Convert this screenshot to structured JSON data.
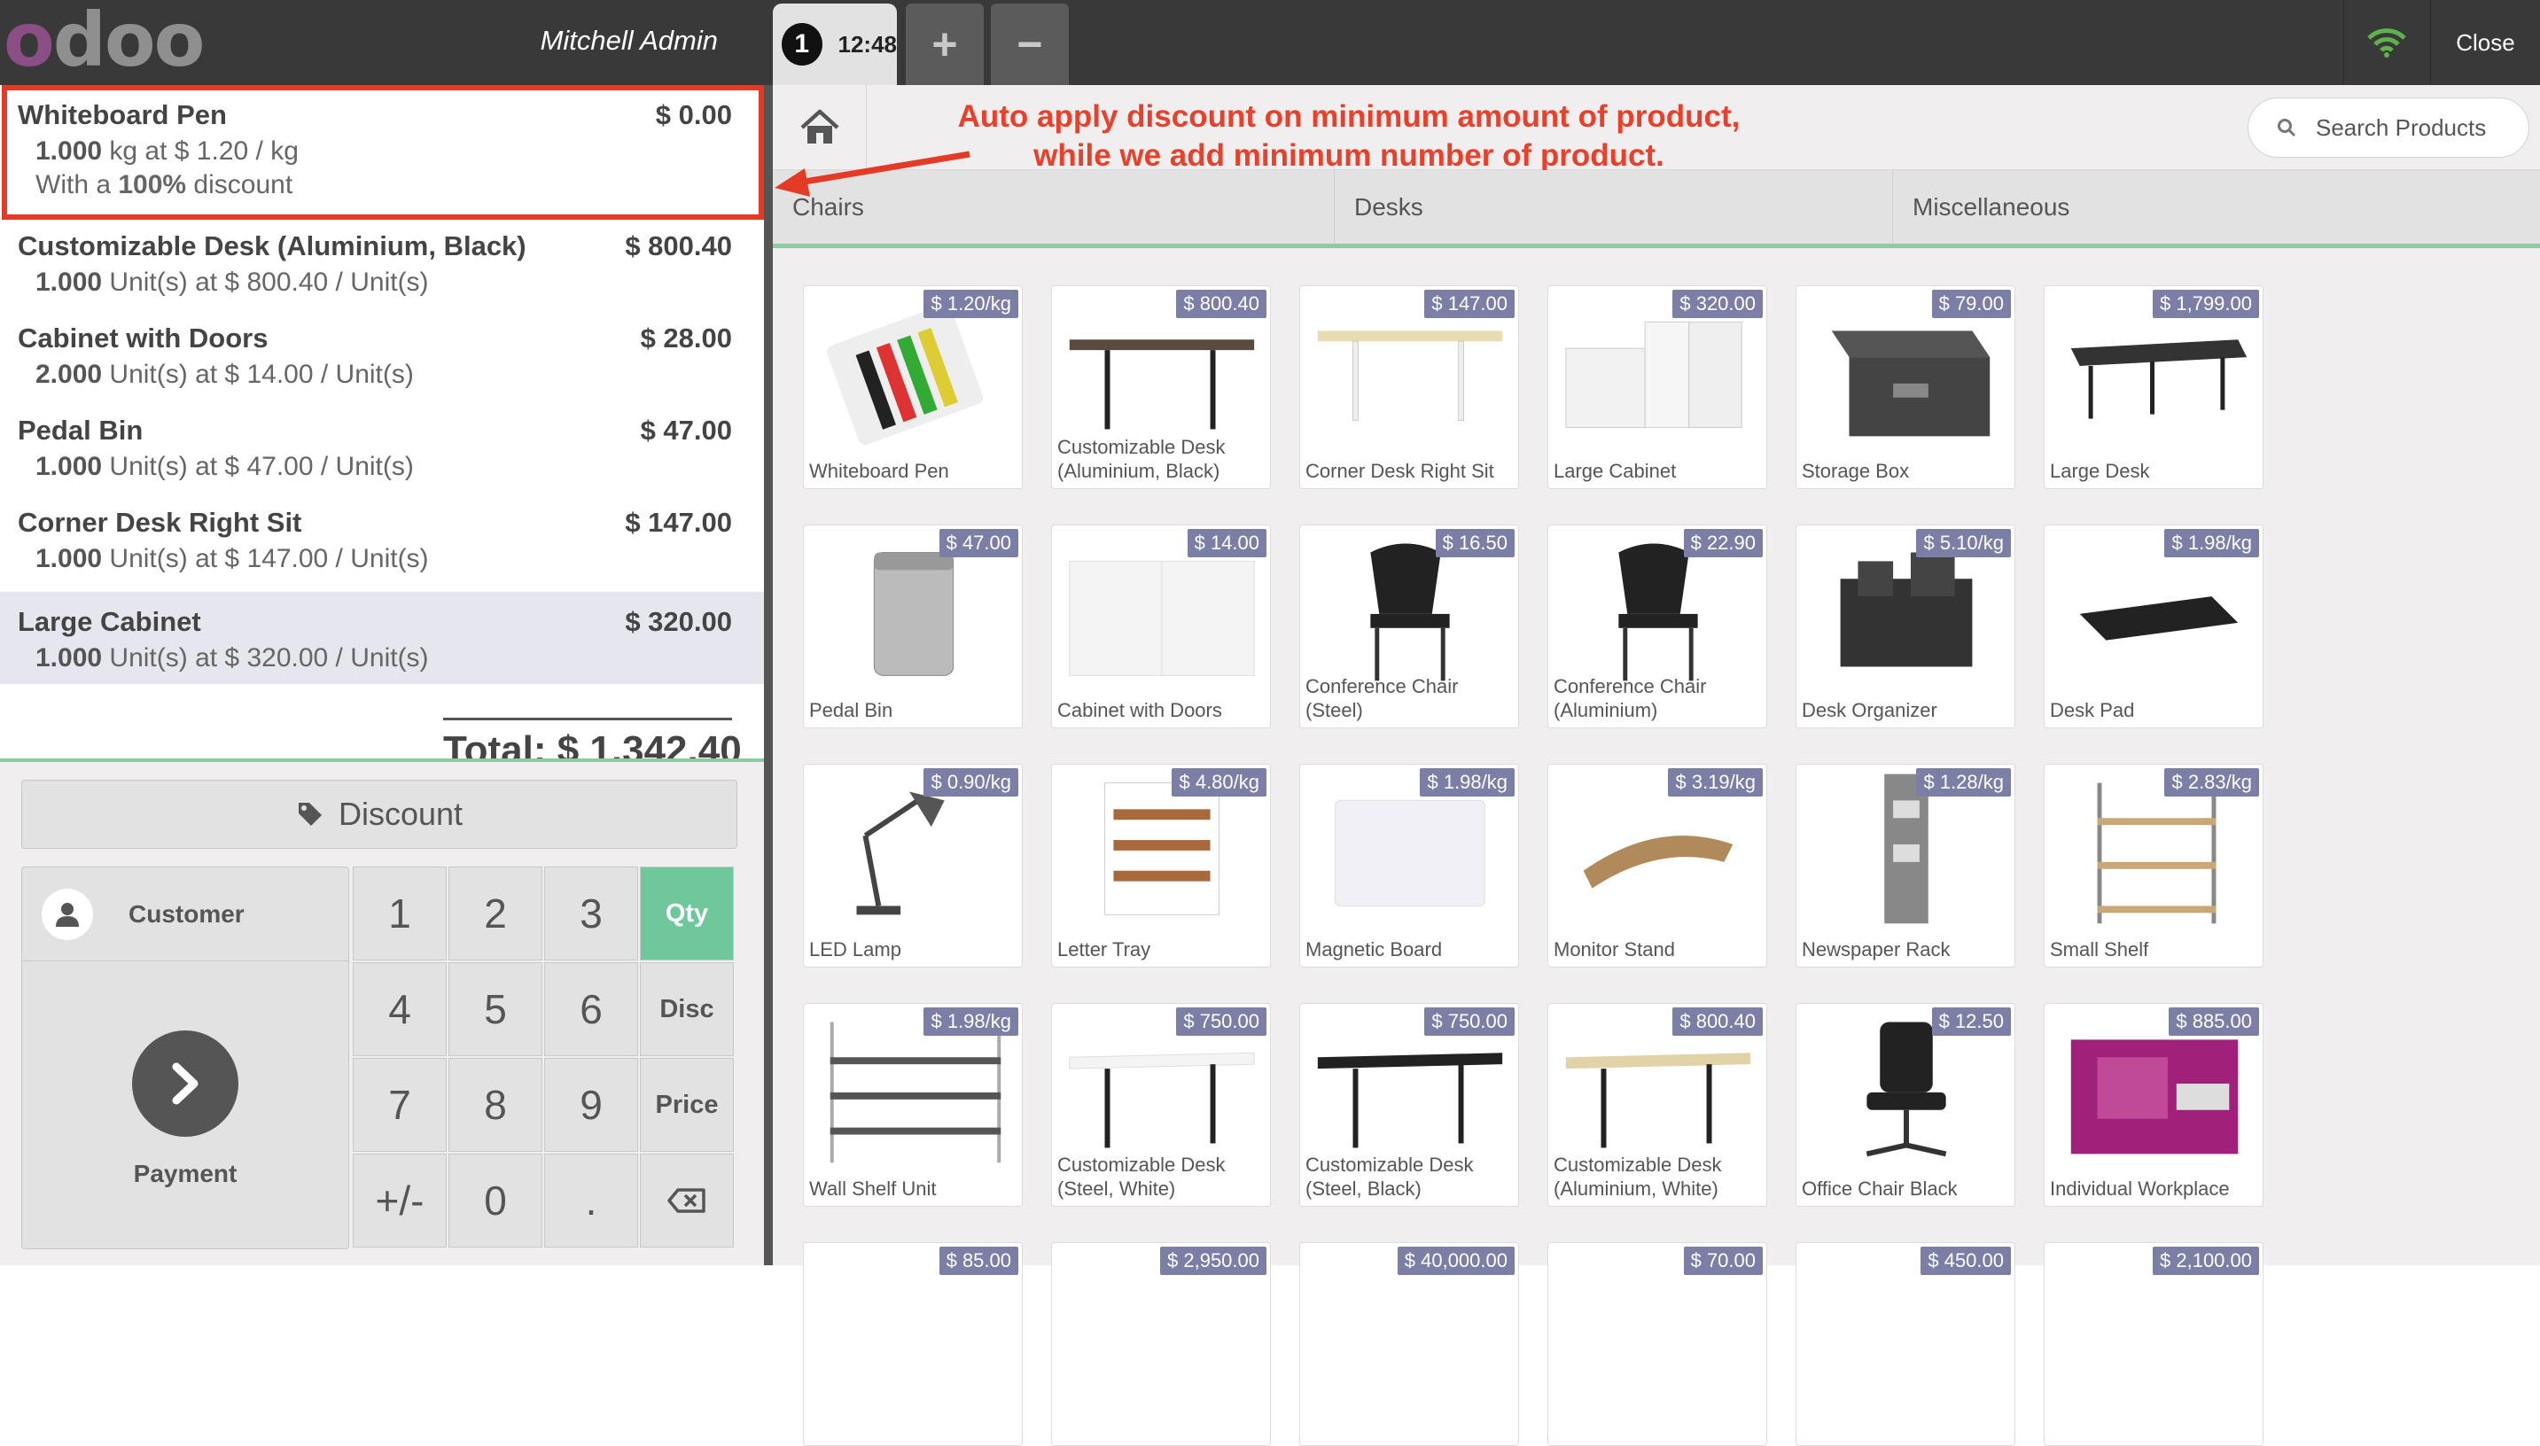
{
  "topbar": {
    "logo_letters": [
      "o",
      "d",
      "o",
      "o"
    ],
    "cashier": "Mitchell Admin",
    "order_number": "1",
    "order_time": "12:48",
    "add_label": "+",
    "remove_label": "−",
    "close_label": "Close",
    "wifi_color": "#5fb14a"
  },
  "order": {
    "lines": [
      {
        "name": "Whiteboard Pen",
        "price": "$ 0.00",
        "qty": "1.000",
        "unit_info": " kg at $ 1.20 / kg",
        "discount_prefix": "With a ",
        "discount_value": "100%",
        "discount_suffix": " discount"
      },
      {
        "name": "Customizable Desk (Aluminium, Black)",
        "price": "$ 800.40",
        "qty": "1.000",
        "unit_info": " Unit(s) at $ 800.40 / Unit(s)"
      },
      {
        "name": "Cabinet with Doors",
        "price": "$ 28.00",
        "qty": "2.000",
        "unit_info": " Unit(s) at $ 14.00 / Unit(s)"
      },
      {
        "name": "Pedal Bin",
        "price": "$ 47.00",
        "qty": "1.000",
        "unit_info": " Unit(s) at $ 47.00 / Unit(s)"
      },
      {
        "name": "Corner Desk Right Sit",
        "price": "$ 147.00",
        "qty": "1.000",
        "unit_info": " Unit(s) at $ 147.00 / Unit(s)"
      },
      {
        "name": "Large Cabinet",
        "price": "$ 320.00",
        "qty": "1.000",
        "unit_info": " Unit(s) at $ 320.00 / Unit(s)"
      }
    ],
    "total": "Total: $ 1,342.40"
  },
  "controls": {
    "discount_label": "Discount",
    "customer_label": "Customer",
    "payment_label": "Payment",
    "keys": [
      "1",
      "2",
      "3",
      "4",
      "5",
      "6",
      "7",
      "8",
      "9",
      "+/-",
      "0",
      "."
    ],
    "modes": [
      "Qty",
      "Disc",
      "Price"
    ],
    "active_mode": "Qty"
  },
  "annotation": {
    "line1": "Auto apply discount on minimum amount of product,",
    "line2": "while we add minimum number of product.",
    "color": "#e43b26"
  },
  "search": {
    "placeholder": "Search Products"
  },
  "categories": [
    "Chairs",
    "Desks",
    "Miscellaneous"
  ],
  "products": [
    {
      "name": "Whiteboard Pen",
      "price": "$ 1.20/kg",
      "icon": "pens"
    },
    {
      "name": "Customizable Desk (Aluminium, Black)",
      "price": "$ 800.40",
      "icon": "desk-dark"
    },
    {
      "name": "Corner Desk Right Sit",
      "price": "$ 147.00",
      "icon": "desk-light"
    },
    {
      "name": "Large Cabinet",
      "price": "$ 320.00",
      "icon": "cabinet"
    },
    {
      "name": "Storage Box",
      "price": "$ 79.00",
      "icon": "box"
    },
    {
      "name": "Large Desk",
      "price": "$ 1,799.00",
      "icon": "large-desk"
    },
    {
      "name": "Pedal Bin",
      "price": "$ 47.00",
      "icon": "bin"
    },
    {
      "name": "Cabinet with Doors",
      "price": "$ 14.00",
      "icon": "cabinet-doors"
    },
    {
      "name": "Conference Chair (Steel)",
      "price": "$ 16.50",
      "icon": "chair"
    },
    {
      "name": "Conference Chair (Aluminium)",
      "price": "$ 22.90",
      "icon": "chair"
    },
    {
      "name": "Desk Organizer",
      "price": "$ 5.10/kg",
      "icon": "organizer"
    },
    {
      "name": "Desk Pad",
      "price": "$ 1.98/kg",
      "icon": "pad"
    },
    {
      "name": "LED Lamp",
      "price": "$ 0.90/kg",
      "icon": "lamp"
    },
    {
      "name": "Letter Tray",
      "price": "$ 4.80/kg",
      "icon": "tray"
    },
    {
      "name": "Magnetic Board",
      "price": "$ 1.98/kg",
      "icon": "board"
    },
    {
      "name": "Monitor Stand",
      "price": "$ 3.19/kg",
      "icon": "stand"
    },
    {
      "name": "Newspaper Rack",
      "price": "$ 1.28/kg",
      "icon": "rack"
    },
    {
      "name": "Small Shelf",
      "price": "$ 2.83/kg",
      "icon": "shelf"
    },
    {
      "name": "Wall Shelf Unit",
      "price": "$ 1.98/kg",
      "icon": "wall-shelf"
    },
    {
      "name": "Customizable Desk (Steel, White)",
      "price": "$ 750.00",
      "icon": "desk-white"
    },
    {
      "name": "Customizable Desk (Steel, Black)",
      "price": "$ 750.00",
      "icon": "desk-black"
    },
    {
      "name": "Customizable Desk (Aluminium, White)",
      "price": "$ 800.40",
      "icon": "desk-wood"
    },
    {
      "name": "Office Chair Black",
      "price": "$ 12.50",
      "icon": "office-chair"
    },
    {
      "name": "Individual Workplace",
      "price": "$ 885.00",
      "icon": "workplace"
    },
    {
      "name": "",
      "price": "$ 85.00",
      "icon": "partial"
    },
    {
      "name": "",
      "price": "$ 2,950.00",
      "icon": "partial"
    },
    {
      "name": "",
      "price": "$ 40,000.00",
      "icon": "partial"
    },
    {
      "name": "",
      "price": "$ 70.00",
      "icon": "partial"
    },
    {
      "name": "",
      "price": "$ 450.00",
      "icon": "partial"
    },
    {
      "name": "",
      "price": "$ 2,100.00",
      "icon": "partial"
    }
  ]
}
